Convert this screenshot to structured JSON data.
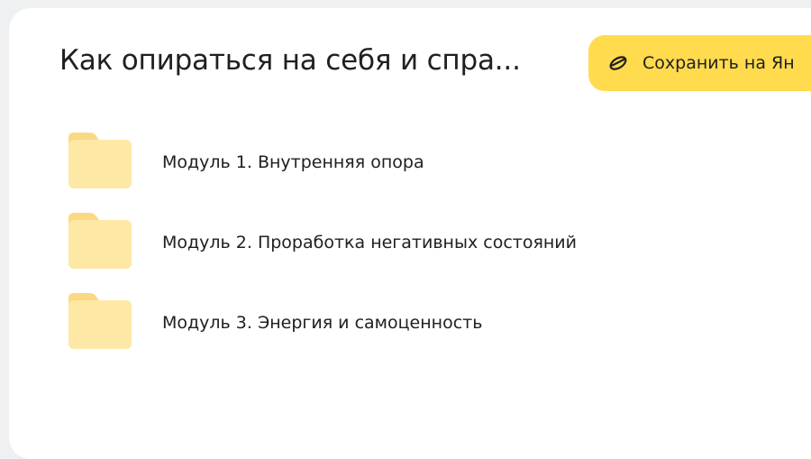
{
  "header": {
    "title": "Как опираться на себя и спра...",
    "save_button_label": "Сохранить на Ян"
  },
  "folders": [
    {
      "name": "Модуль 1. Внутренняя опора",
      "icon": "folder-icon"
    },
    {
      "name": "Модуль 2. Проработка негативных состояний",
      "icon": "folder-icon"
    },
    {
      "name": "Модуль 3. Энергия и самоценность",
      "icon": "folder-icon"
    }
  ],
  "colors": {
    "page_background": "#eef0f2",
    "card_background": "#ffffff",
    "button_accent": "#ffdb4d",
    "folder_body": "#fde8a6",
    "folder_tab": "#fbd982",
    "text": "#21201f"
  },
  "icons": {
    "save_button_icon": "disk-save-icon"
  }
}
